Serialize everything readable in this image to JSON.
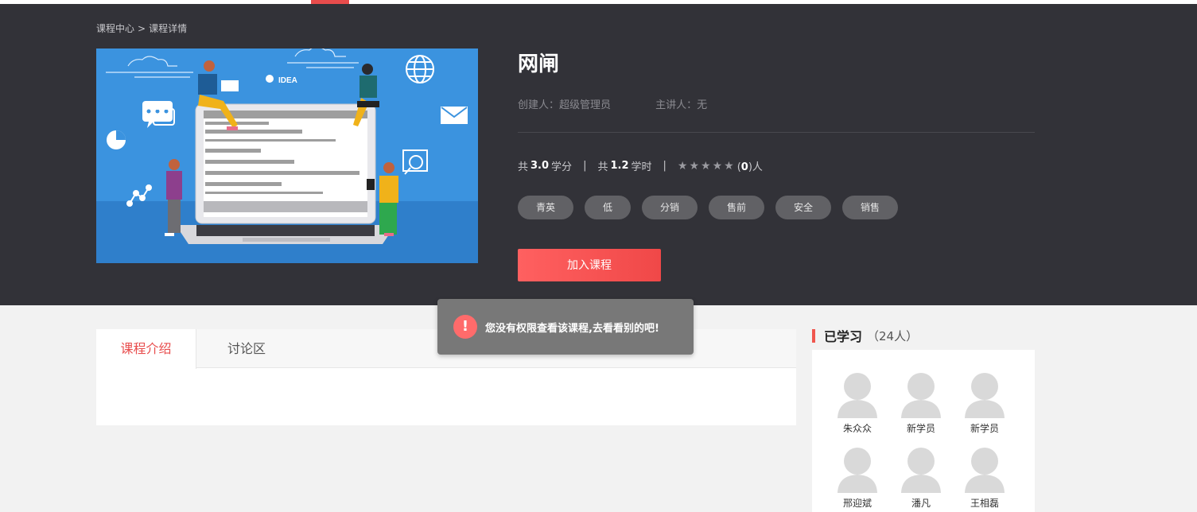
{
  "breadcrumb": {
    "home": "课程中心",
    "separator": ">",
    "current": "课程详情"
  },
  "course": {
    "title": "网闸",
    "creator": "创建人：超级管理员",
    "lecturer": "主讲人：无",
    "credits_prefix": "共",
    "credits_value": "3.0",
    "credits_unit": "学分",
    "hours_prefix": "共",
    "hours_value": "1.2",
    "hours_unit": "学时",
    "separator": "|",
    "rating_stars": 5,
    "rating_open": "(",
    "rating_count": "0",
    "rating_close": ")人",
    "tags": [
      "青英",
      "低",
      "分销",
      "售前",
      "安全",
      "销售"
    ],
    "join_label": "加入课程"
  },
  "cover": {
    "idea_label": "IDEA"
  },
  "tabs": [
    {
      "label": "课程介绍",
      "active": true
    },
    {
      "label": "讨论区",
      "active": false
    }
  ],
  "learners_panel": {
    "title": "已学习",
    "count": "（24人）",
    "learners": [
      "朱众众",
      "新学员",
      "新学员",
      "邢迎斌",
      "潘凡",
      "王相磊"
    ]
  },
  "toast": {
    "icon": "!",
    "message": "您没有权限查看该课程,去看看别的吧!"
  },
  "colors": {
    "accent": "#e84c4c",
    "hero_bg": "#323238",
    "tag_bg": "#616165",
    "toast_bg": "#787878"
  }
}
